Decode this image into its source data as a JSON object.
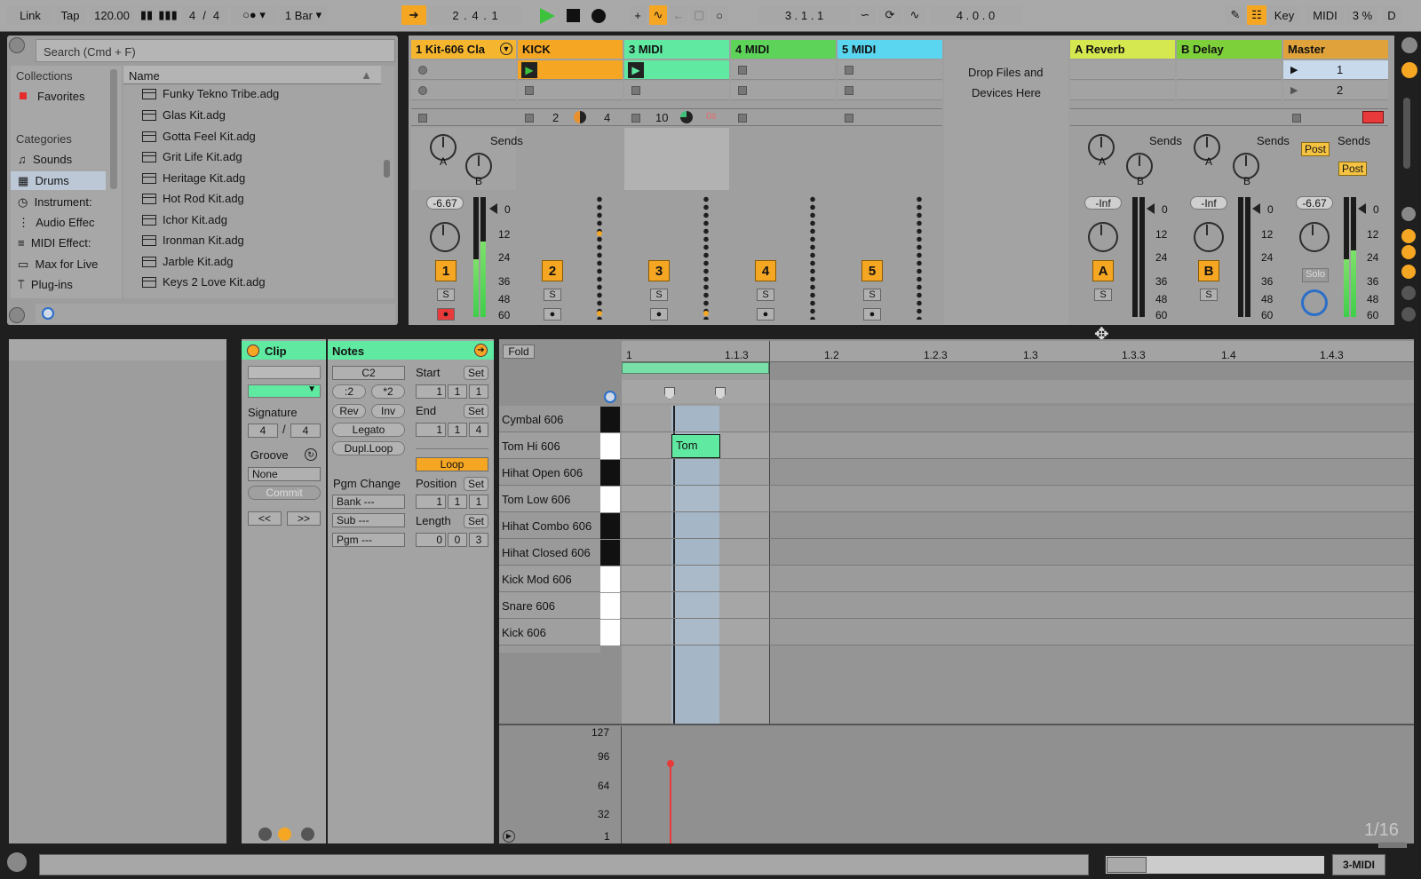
{
  "transport": {
    "link": "Link",
    "tap": "Tap",
    "tempo": "120.00",
    "sig_num": "4",
    "sig_slash": "/",
    "sig_den": "4",
    "quantize": "1 Bar",
    "position": "2 .  4 .  1",
    "loop_start": "3 .  1 .  1",
    "loop_length": "4 .  0 .  0",
    "key": "Key",
    "midi": "MIDI",
    "cpu": "3 %",
    "disk": "D"
  },
  "browser": {
    "search_placeholder": "Search (Cmd + F)",
    "collections_title": "Collections",
    "favorites": "Favorites",
    "categories_title": "Categories",
    "categories": [
      "Sounds",
      "Drums",
      "Instrument:",
      "Audio Effec",
      "MIDI Effect:",
      "Max for Live",
      "Plug-ins"
    ],
    "name_header": "Name",
    "files": [
      "Funky Tekno Tribe.adg",
      "Glas Kit.adg",
      "Gotta Feel Kit.adg",
      "Grit Life Kit.adg",
      "Heritage Kit.adg",
      "Hot Rod Kit.adg",
      "Ichor Kit.adg",
      "Ironman Kit.adg",
      "Jarble Kit.adg",
      "Keys 2 Love Kit.adg"
    ]
  },
  "tracks": [
    {
      "name": "1 Kit-606 Cla",
      "color": "#f5b52e",
      "vol": "-6.67",
      "num": "1"
    },
    {
      "name": "KICK",
      "color": "#f5a623",
      "num": "2"
    },
    {
      "name": "3 MIDI",
      "color": "#5fe9a1",
      "num": "3"
    },
    {
      "name": "4 MIDI",
      "color": "#5ed35a",
      "num": "4"
    },
    {
      "name": "5 MIDI",
      "color": "#5ad6f0",
      "num": "5"
    }
  ],
  "returns": [
    {
      "name": "A Reverb",
      "color": "#d6e84f",
      "vol": "-Inf",
      "num": "A"
    },
    {
      "name": "B Delay",
      "color": "#7ed03b",
      "vol": "-Inf",
      "num": "B"
    }
  ],
  "master": {
    "name": "Master",
    "color": "#e0a23a",
    "vol": "-6.67",
    "scenes": [
      "1",
      "2"
    ],
    "solo": "Solo",
    "post": "Post"
  },
  "mixer": {
    "sends": "Sends",
    "knob_a": "A",
    "knob_b": "B",
    "solo_btn": "S",
    "drop_text_1": "Drop Files and",
    "drop_text_2": "Devices Here",
    "kick_stats": [
      "2",
      "4"
    ],
    "midi_stat": "10",
    "midi_ghost": "0s",
    "scale": [
      "0",
      "12",
      "24",
      "36",
      "48",
      "60"
    ]
  },
  "clip": {
    "title": "Clip",
    "signature_label": "Signature",
    "sig_num": "4",
    "sig_den": "4",
    "groove_label": "Groove",
    "groove_value": "None",
    "commit": "Commit",
    "prev": "<<",
    "next": ">>"
  },
  "notes": {
    "title": "Notes",
    "key": "C2",
    "half": ":2",
    "double": "*2",
    "rev": "Rev",
    "inv": "Inv",
    "legato": "Legato",
    "dupl": "Dupl.Loop",
    "start_label": "Start",
    "end_label": "End",
    "set": "Set",
    "start": [
      "1",
      "1",
      "1"
    ],
    "end": [
      "1",
      "1",
      "4"
    ],
    "loop": "Loop",
    "position_label": "Position",
    "position": [
      "1",
      "1",
      "1"
    ],
    "length_label": "Length",
    "length": [
      "0",
      "0",
      "3"
    ],
    "pgm_change": "Pgm Change",
    "bank": "Bank ---",
    "sub": "Sub ---",
    "pgm": "Pgm ---"
  },
  "piano_roll": {
    "fold": "Fold",
    "ruler": [
      "1",
      "1.1.3",
      "1.2",
      "1.2.3",
      "1.3",
      "1.3.3",
      "1.4",
      "1.4.3"
    ],
    "keys": [
      "Cymbal 606",
      "Tom Hi 606",
      "Hihat Open 606",
      "Tom Low 606",
      "Hihat Combo 606",
      "Hihat Closed 606",
      "Kick Mod 606",
      "Snare 606",
      "Kick 606"
    ],
    "note_label": "Tom",
    "velocity_scale": [
      "127",
      "96",
      "64",
      "32",
      "1"
    ],
    "grid": "1/16"
  },
  "status": {
    "track_name": "3-MIDI"
  }
}
